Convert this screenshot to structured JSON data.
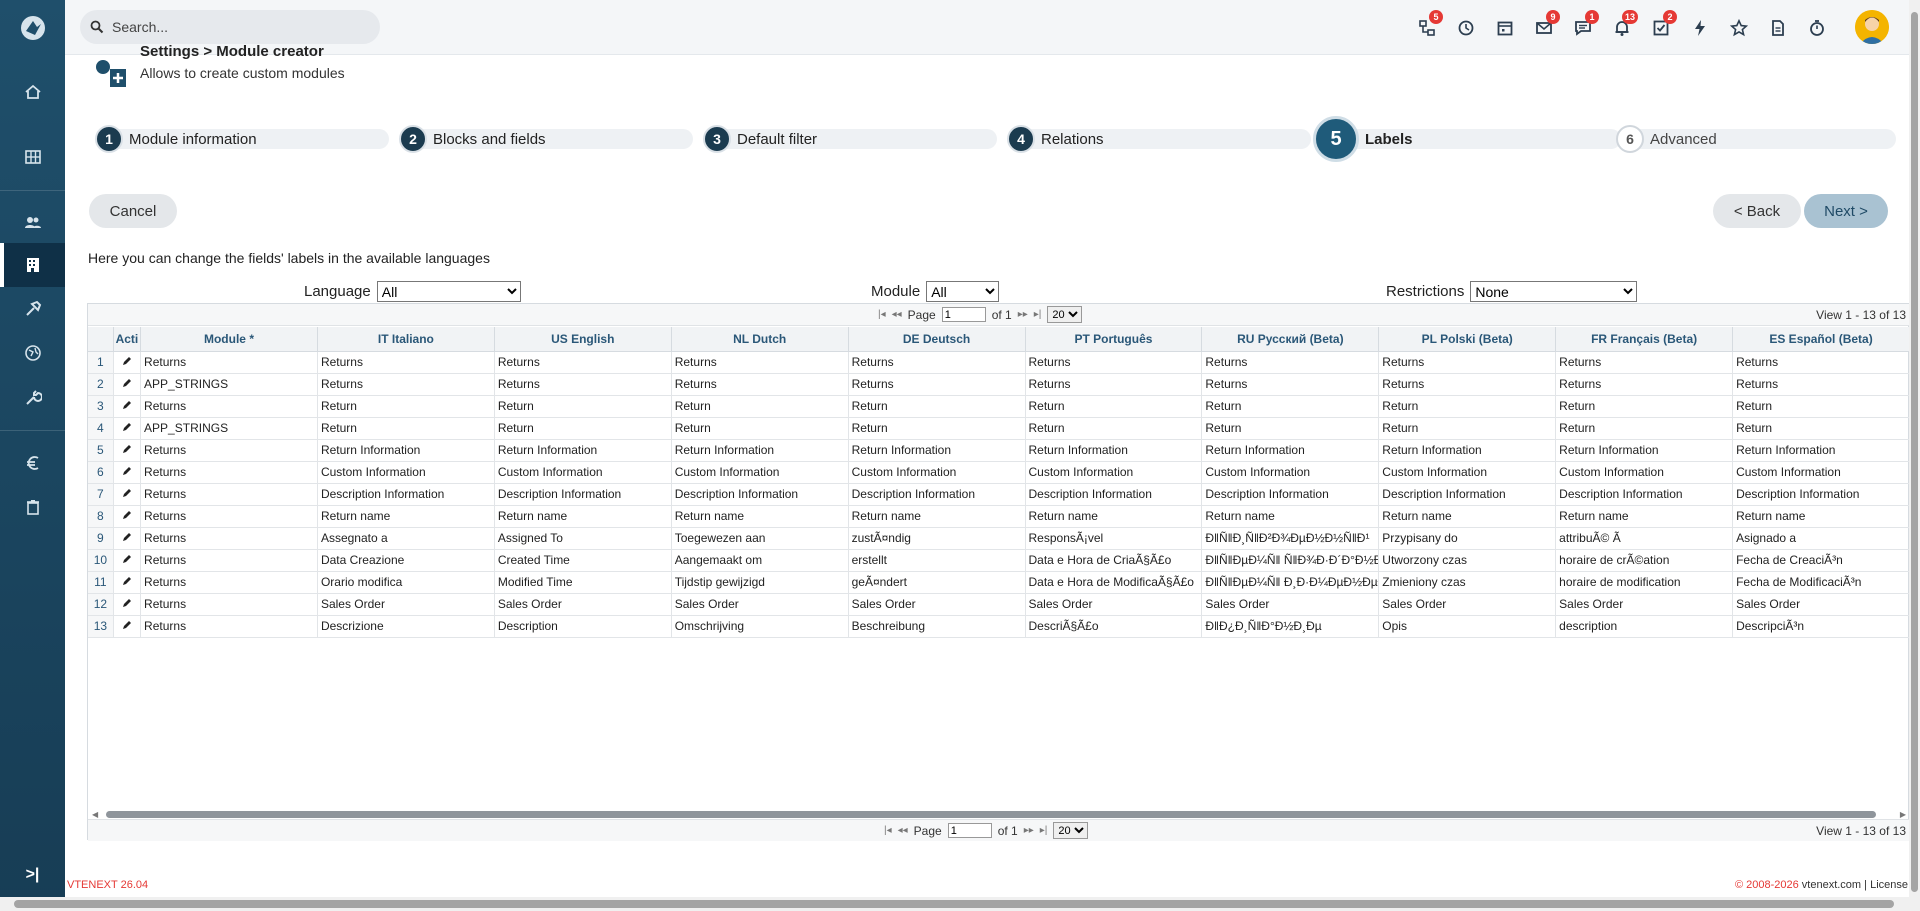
{
  "topbar": {
    "search_placeholder": "Search...",
    "icons": [
      {
        "name": "process-icon",
        "badge": "5"
      },
      {
        "name": "history-icon",
        "badge": ""
      },
      {
        "name": "calendar-icon",
        "badge": ""
      },
      {
        "name": "mail-icon",
        "badge": "9"
      },
      {
        "name": "chat-icon",
        "badge": "1"
      },
      {
        "name": "bell-icon",
        "badge": "13"
      },
      {
        "name": "tasks-icon",
        "badge": "2"
      },
      {
        "name": "lightning-icon",
        "badge": ""
      },
      {
        "name": "star-icon",
        "badge": ""
      },
      {
        "name": "document-icon",
        "badge": ""
      },
      {
        "name": "timer-icon",
        "badge": ""
      }
    ]
  },
  "page": {
    "title": "Settings > Module creator",
    "subtitle": "Allows to create custom modules"
  },
  "steps": [
    {
      "num": "1",
      "label": "Module information"
    },
    {
      "num": "2",
      "label": "Blocks and fields"
    },
    {
      "num": "3",
      "label": "Default filter"
    },
    {
      "num": "4",
      "label": "Relations"
    },
    {
      "num": "5",
      "label": "Labels"
    },
    {
      "num": "6",
      "label": "Advanced"
    }
  ],
  "buttons": {
    "cancel": "Cancel",
    "back": "< Back",
    "next": "Next >"
  },
  "intro": "Here you can change the fields' labels in the available languages",
  "filters": {
    "language_label": "Language",
    "language_value": "All",
    "module_label": "Module",
    "module_value": "All",
    "restrictions_label": "Restrictions",
    "restrictions_value": "None"
  },
  "pager": {
    "page_label": "Page",
    "page_value": "1",
    "of_label": "of 1",
    "per_page": "20",
    "view": "View 1 - 13 of 13"
  },
  "table": {
    "headers": [
      "Acti",
      "Module *",
      "IT Italiano",
      "US English",
      "NL Dutch",
      "DE Deutsch",
      "PT Português",
      "RU Русский (Beta)",
      "PL Polski (Beta)",
      "FR Français (Beta)",
      "ES Español (Beta)"
    ],
    "rows": [
      [
        "1",
        "Returns",
        "Returns",
        "Returns",
        "Returns",
        "Returns",
        "Returns",
        "Returns",
        "Returns",
        "Returns",
        "Returns"
      ],
      [
        "2",
        "APP_STRINGS",
        "Returns",
        "Returns",
        "Returns",
        "Returns",
        "Returns",
        "Returns",
        "Returns",
        "Returns",
        "Returns"
      ],
      [
        "3",
        "Returns",
        "Return",
        "Return",
        "Return",
        "Return",
        "Return",
        "Return",
        "Return",
        "Return",
        "Return"
      ],
      [
        "4",
        "APP_STRINGS",
        "Return",
        "Return",
        "Return",
        "Return",
        "Return",
        "Return",
        "Return",
        "Return",
        "Return"
      ],
      [
        "5",
        "Returns",
        "Return Information",
        "Return Information",
        "Return Information",
        "Return Information",
        "Return Information",
        "Return Information",
        "Return Information",
        "Return Information",
        "Return Information"
      ],
      [
        "6",
        "Returns",
        "Custom Information",
        "Custom Information",
        "Custom Information",
        "Custom Information",
        "Custom Information",
        "Custom Information",
        "Custom Information",
        "Custom Information",
        "Custom Information"
      ],
      [
        "7",
        "Returns",
        "Description Information",
        "Description Information",
        "Description Information",
        "Description Information",
        "Description Information",
        "Description Information",
        "Description Information",
        "Description Information",
        "Description Information"
      ],
      [
        "8",
        "Returns",
        "Return name",
        "Return name",
        "Return name",
        "Return name",
        "Return name",
        "Return name",
        "Return name",
        "Return name",
        "Return name"
      ],
      [
        "9",
        "Returns",
        "Assegnato a",
        "Assigned To",
        "Toegewezen aan",
        "zustÃ¤ndig",
        "ResponsÃ¡vel",
        "Ð‖Ñ‖Ð¸Ñ‖Ð²Ð¾ÐµÐ½Ð½Ñ‖Ð¹",
        "Przypisany do",
        "attribuÃ© Ã",
        "Asignado a"
      ],
      [
        "10",
        "Returns",
        "Data Creazione",
        "Created Time",
        "Aangemaakt om",
        "erstellt",
        "Data e Hora de CriaÃ§Ã£o",
        "Ð‖Ñ‖ÐµÐ¼Ñ‖ Ñ‖Ð¾Ð·Ð´Ð°Ð½Ð¸Ñ‖",
        "Utworzony czas",
        "horaire de crÃ©ation",
        "Fecha de CreaciÃ³n"
      ],
      [
        "11",
        "Returns",
        "Orario modifica",
        "Modified Time",
        "Tijdstip gewijzigd",
        "geÃ¤ndert",
        "Data e Hora de ModificaÃ§Ã£o",
        "Ð‖Ñ‖ÐµÐ¼Ñ‖ Ð¸Ð·Ð¼ÐµÐ½ÐµÐ½Ð¸Ñ‖",
        "Zmieniony czas",
        "horaire de modification",
        "Fecha de ModificaciÃ³n"
      ],
      [
        "12",
        "Returns",
        "Sales Order",
        "Sales Order",
        "Sales Order",
        "Sales Order",
        "Sales Order",
        "Sales Order",
        "Sales Order",
        "Sales Order",
        "Sales Order"
      ],
      [
        "13",
        "Returns",
        "Descrizione",
        "Description",
        "Omschrijving",
        "Beschreibung",
        "DescriÃ§Ã£o",
        "Ð‖Ð¿Ð¸Ñ‖Ð°Ð½Ð¸Ðµ",
        "Opis",
        "description",
        "DescripciÃ³n"
      ]
    ]
  },
  "footer": {
    "version": "VTENEXT 26.04",
    "copyright": "© 2008-2026",
    "site": "vtenext.com",
    "separator": "|",
    "license": "License"
  },
  "colors": {
    "sidebar": "#1f4f6b",
    "accent": "#1f5b7a",
    "badge": "#e53935"
  }
}
